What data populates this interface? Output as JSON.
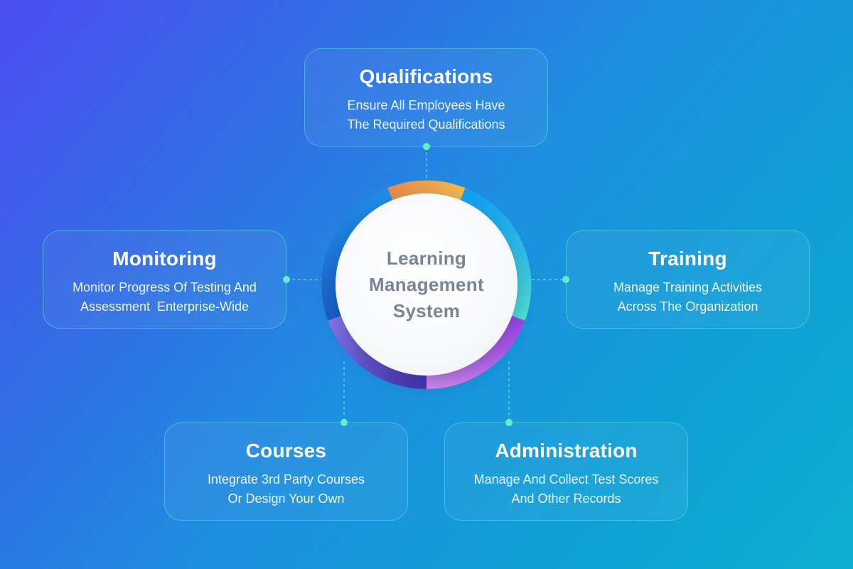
{
  "hub": {
    "lines": [
      "Learning",
      "Management",
      "System"
    ]
  },
  "cards": {
    "qualifications": {
      "title": "Qualifications",
      "lines": [
        "Ensure All Employees Have",
        "The Required Qualifications"
      ]
    },
    "monitoring": {
      "title": "Monitoring",
      "lines": [
        "Monitor Progress Of Testing And",
        "Assessment  Enterprise-Wide"
      ]
    },
    "training": {
      "title": "Training",
      "lines": [
        "Manage Training Activities",
        "Across The Organization"
      ]
    },
    "courses": {
      "title": "Courses",
      "lines": [
        "Integrate 3rd Party Courses",
        "Or Design Your Own"
      ]
    },
    "administration": {
      "title": "Administration",
      "lines": [
        "Manage And Collect Test Scores",
        "And Other Records"
      ]
    }
  },
  "colors": {
    "background_start": "#4d4ef0",
    "background_end": "#10aece",
    "card_border": "#58e8d6",
    "connector_dot": "#5ef0c8",
    "hub_text": "#7a8494",
    "ring_segments": [
      "#eda14a",
      "#1ab0f2",
      "#a44fe2",
      "#5a46c8",
      "#1c6fd4"
    ]
  }
}
